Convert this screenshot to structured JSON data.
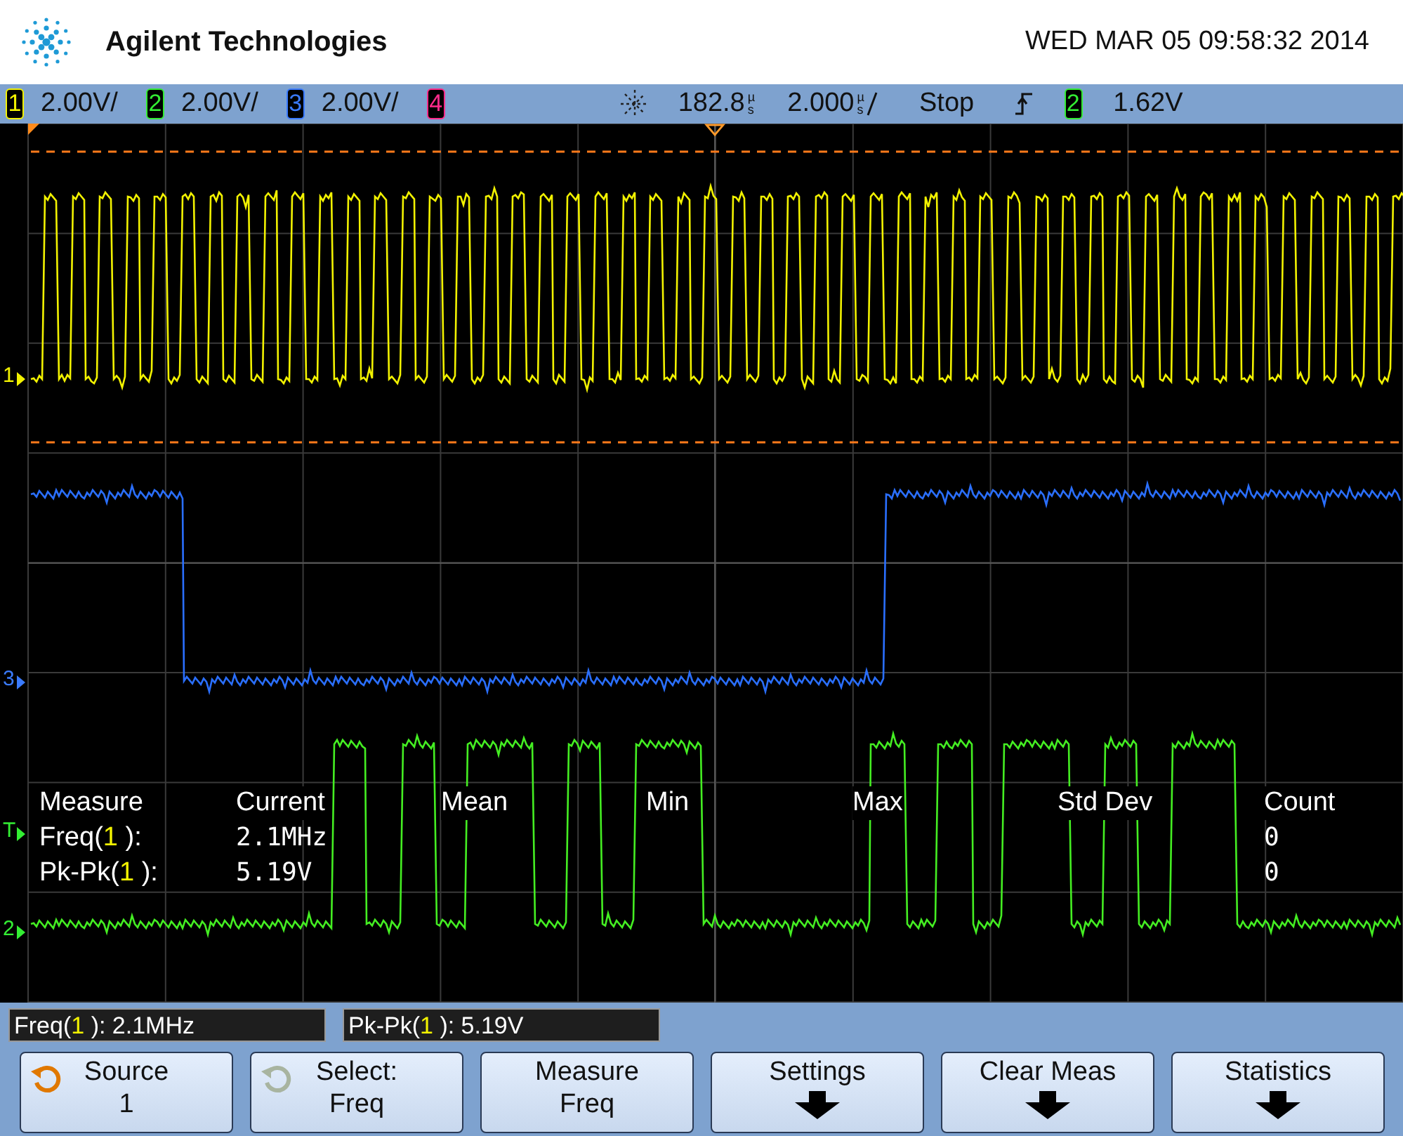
{
  "header": {
    "brand": "Agilent Technologies",
    "datetime": "WED MAR 05 09:58:32 2014"
  },
  "status_bar": {
    "channels": [
      {
        "number": "1",
        "scale": "2.00V/",
        "color": "#f2f200"
      },
      {
        "number": "2",
        "scale": "2.00V/",
        "color": "#33ee33"
      },
      {
        "number": "3",
        "scale": "2.00V/",
        "color": "#3a7bff"
      },
      {
        "number": "4",
        "color": "#ff2a8a"
      }
    ],
    "delay": "182.8",
    "delay_unit": "µs",
    "timebase": "2.000",
    "timebase_unit": "µs",
    "run_state": "Stop",
    "trigger_source": {
      "number": "2",
      "color": "#33ee33"
    },
    "trigger_level": "1.62V"
  },
  "screen": {
    "markers": [
      {
        "label": "1",
        "color": "#f2f200"
      },
      {
        "label": "3",
        "color": "#3a7bff"
      },
      {
        "label": "T",
        "color": "#33ee33"
      },
      {
        "label": "2",
        "color": "#33ee33"
      }
    ],
    "measurements": {
      "columns": [
        "Measure",
        "Current",
        "Mean",
        "Min",
        "Max",
        "Std Dev",
        "Count"
      ],
      "rows": [
        {
          "name": "Freq(",
          "source": "1",
          "close": " ):",
          "current": "2.1MHz",
          "count": "0"
        },
        {
          "name": "Pk-Pk(",
          "source": "1",
          "close": " ):",
          "current": "5.19V",
          "count": "0"
        }
      ]
    }
  },
  "readouts": [
    {
      "name": "Freq(",
      "source": "1",
      "close": " ): 2.1MHz"
    },
    {
      "name": "Pk-Pk(",
      "source": "1",
      "close": " ): 5.19V"
    }
  ],
  "softkeys": [
    {
      "kind": "knob",
      "knob_active": true,
      "label": "Source",
      "value": "1"
    },
    {
      "kind": "knob",
      "knob_active": false,
      "label": "Select:",
      "value": "Freq"
    },
    {
      "kind": "plain",
      "label": "Measure",
      "value": "Freq"
    },
    {
      "kind": "menu",
      "label": "Settings"
    },
    {
      "kind": "menu",
      "label": "Clear Meas"
    },
    {
      "kind": "menu",
      "label": "Statistics"
    }
  ]
}
